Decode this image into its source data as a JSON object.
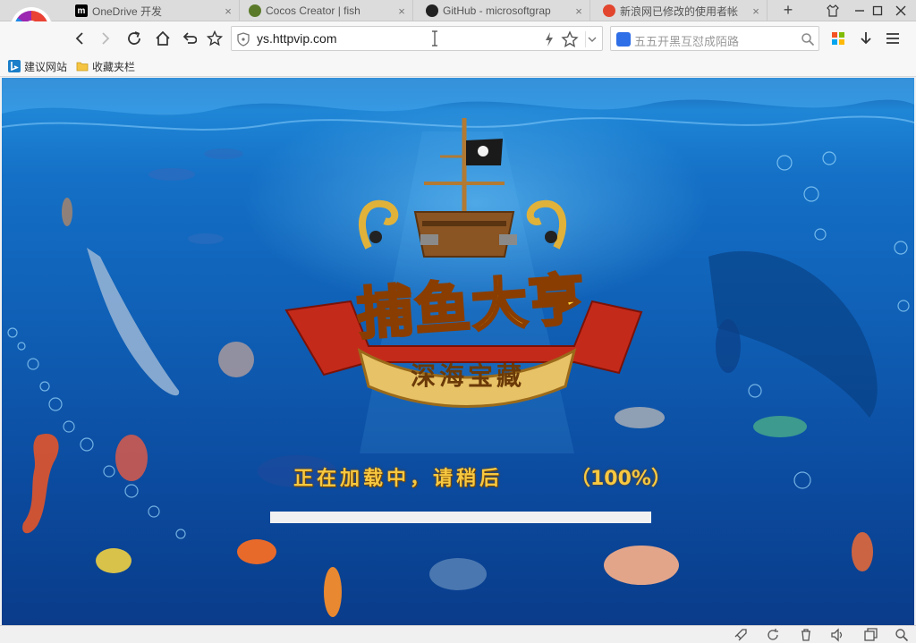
{
  "browser": {
    "tabs": [
      {
        "title": "OneDrive 开发",
        "favicon": "onedrive-m-icon",
        "color": "#000000"
      },
      {
        "title": "Cocos Creator | fish",
        "favicon": "cocos-icon",
        "color": "#5a7a2a"
      },
      {
        "title": "GitHub - microsoftgrap",
        "favicon": "github-icon",
        "color": "#222222"
      },
      {
        "title": "新浪网已修改的使用者帐",
        "favicon": "weibo-icon",
        "color": "#e2462f"
      }
    ],
    "new_tab_label": "+",
    "address": {
      "url": "ys.httpvip.com"
    },
    "search": {
      "placeholder": "五五开黑互怼成陌路"
    },
    "bookmarks": [
      {
        "label": "建议网站",
        "icon": "bing-icon"
      },
      {
        "label": "收藏夹栏",
        "icon": "folder-icon"
      }
    ]
  },
  "game": {
    "title": "捕鱼大亨",
    "subtitle": "深海宝藏",
    "loading_text": "正在加载中，请稍后",
    "loading_percent": "（100%）",
    "progress": 1.0
  },
  "colors": {
    "accent_gold": "#f7c840",
    "ocean": "#0f5fb5",
    "progress_fill": "#f1f1f1"
  }
}
